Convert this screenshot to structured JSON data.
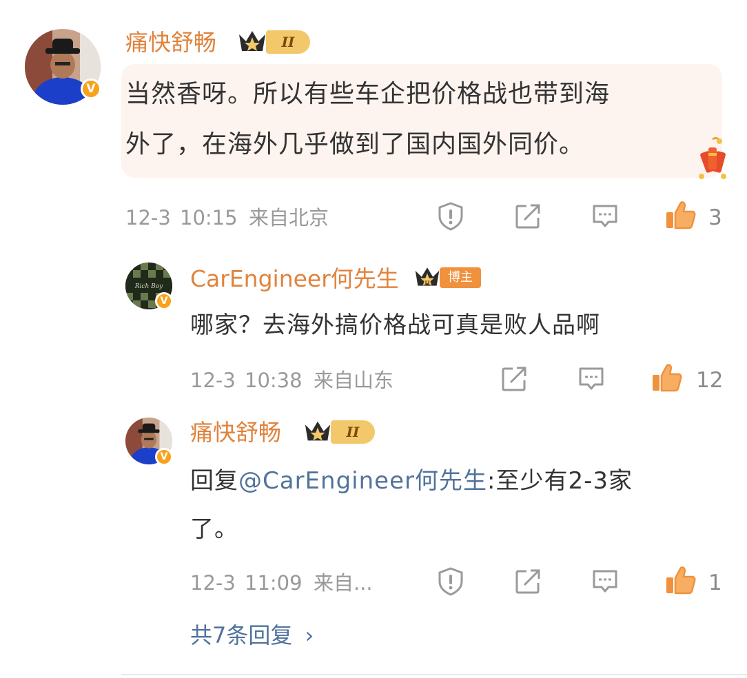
{
  "comments": [
    {
      "username": "痛快舒畅",
      "rank_badge": "II",
      "content_lines": [
        "当然香呀。所以有些车企把价格战也带到海",
        "外了，在海外几乎做到了国内国外同价。"
      ],
      "date": "12-3",
      "time": "10:15",
      "location": "来自北京",
      "like_count": "3",
      "verified_mark": "V"
    }
  ],
  "replies": [
    {
      "username": "CarEngineer何先生",
      "host_badge": "博主",
      "avatar_text": "Rich Boy",
      "content": "哪家？去海外搞价格战可真是败人品啊",
      "date": "12-3",
      "time": "10:38",
      "location": "来自山东",
      "like_count": "12",
      "verified_mark": "V"
    },
    {
      "username": "痛快舒畅",
      "rank_badge": "II",
      "content_prefix": "回复",
      "mention": "@CarEngineer何先生",
      "content_after": ":至少有2-3家",
      "content_line2": "了。",
      "date": "12-3",
      "time": "11:09",
      "location": "来自...",
      "like_count": "1",
      "verified_mark": "V"
    }
  ],
  "more_replies": {
    "label": "共7条回复",
    "chevron": "›"
  },
  "icons": [
    "report-icon",
    "share-icon",
    "comment-icon",
    "like-icon",
    "crown-icon",
    "firecracker-icon"
  ],
  "colors": {
    "username": "#e0833c",
    "mention": "#50739c",
    "meta": "#999999",
    "like": "#f0913e",
    "bubble": "#fdf3ef"
  }
}
